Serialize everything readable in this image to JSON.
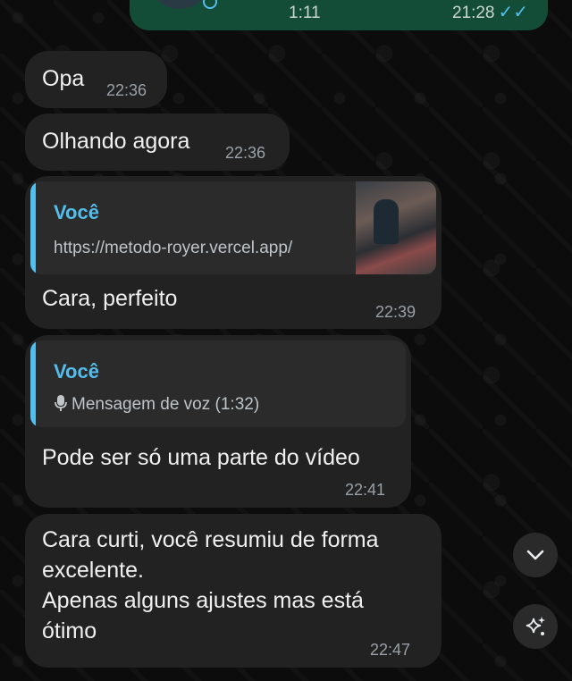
{
  "outgoing_voice": {
    "duration": "1:11",
    "time": "21:28",
    "ticks": "✓✓"
  },
  "messages": [
    {
      "text": "Opa",
      "time": "22:36"
    },
    {
      "text": "Olhando agora",
      "time": "22:36"
    },
    {
      "quote_author": "Você",
      "quote_text": "https://metodo-royer.vercel.app/",
      "text": "Cara, perfeito",
      "time": "22:39"
    },
    {
      "quote_author": "Você",
      "quote_text": "Mensagem de voz (1:32)",
      "text": "Pode ser só uma parte do vídeo",
      "time": "22:41"
    },
    {
      "lines": [
        "Cara curti, você resumiu de forma",
        "excelente.",
        "Apenas alguns ajustes mas está",
        "ótimo"
      ],
      "time": "22:47"
    }
  ],
  "icons": {
    "scroll_down": "chevron-down-icon",
    "sparkle": "sparkle-icon"
  }
}
